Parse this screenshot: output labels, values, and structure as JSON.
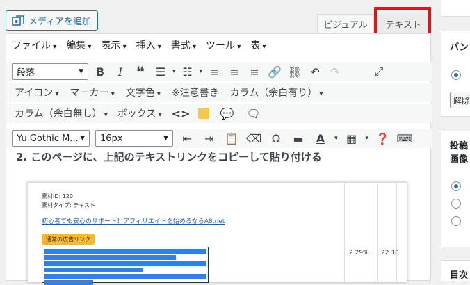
{
  "media_button": {
    "label": "メディアを追加"
  },
  "tabs": {
    "visual": "ビジュアル",
    "text": "テキスト"
  },
  "menubar": [
    "ファイル",
    "編集",
    "表示",
    "挿入",
    "書式",
    "ツール",
    "表"
  ],
  "toolbar": {
    "block_format": "段落",
    "row2": [
      "アイコン",
      "マーカー",
      "文字色",
      "※注意書き",
      "カラム（余白有り）"
    ],
    "row3": [
      "カラム（余白無し）",
      "ボックス"
    ],
    "font_family": "Yu Gothic M...",
    "font_size": "16px"
  },
  "content": {
    "heading": "2. このページに、上記のテキストリンクをコピーして貼り付ける",
    "shot": {
      "id_line": "素材ID: 120",
      "type_line": "素材タイプ: テキスト",
      "link": "初心者でも安心のサポート！アフィリエイトを始めるならA8.net",
      "badge": "通常の広告リンク",
      "pct": "2.29%",
      "num": "22.10"
    }
  },
  "side": {
    "panel1_title": "パン",
    "panel1_button": "解除",
    "panel2_title_1": "投稿",
    "panel2_title_2": "画像",
    "panel3_title": "目次"
  },
  "colors": {
    "accent": "#2271b1",
    "highlight": "#e0151c"
  }
}
